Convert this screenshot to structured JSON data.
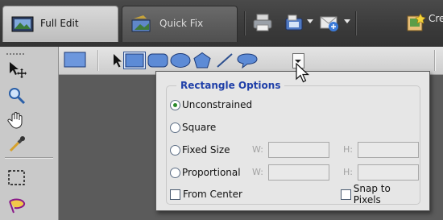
{
  "modebar": {
    "tabs": [
      {
        "label": "Full Edit",
        "icon": "full-edit-icon",
        "active": true
      },
      {
        "label": "Quick Fix",
        "icon": "quick-fix-icon",
        "active": false
      }
    ],
    "buttons": [
      {
        "icon": "print-icon"
      },
      {
        "icon": "organize-icon",
        "has_dropdown": true
      },
      {
        "icon": "share-icon",
        "has_dropdown": true
      },
      {
        "icon": "create-icon"
      }
    ],
    "create_label": "Crea"
  },
  "toolbox": {
    "tools": [
      "move-tool-icon",
      "zoom-tool-icon",
      "hand-tool-icon",
      "eyedropper-tool-icon",
      "marquee-tool-icon",
      "lasso-tool-icon"
    ]
  },
  "options_bar": {
    "shapes": [
      "rectangle-shape",
      "rounded-rectangle-shape",
      "ellipse-shape",
      "polygon-shape",
      "line-shape",
      "custom-shape"
    ]
  },
  "rectangle_options": {
    "title": "Rectangle Options",
    "options": {
      "unconstrained": "Unconstrained",
      "square": "Square",
      "fixed_size": "Fixed Size",
      "proportional": "Proportional"
    },
    "selected": "Unconstrained",
    "w_label": "W:",
    "h_label": "H:",
    "from_center": "From Center",
    "snap_to_pixels": "Snap to Pixels"
  },
  "colors": {
    "title_blue": "#1f3fa8",
    "radio_selected": "#2a8a2a",
    "shape_fill": "#5d8bd6"
  }
}
